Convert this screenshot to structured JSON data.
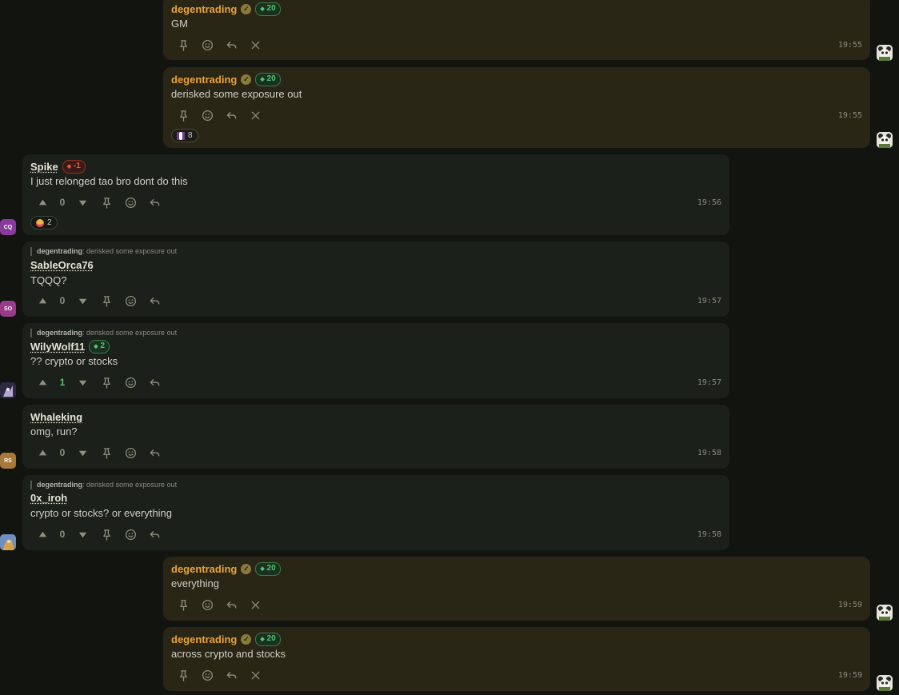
{
  "colors": {
    "background": "#121410",
    "own_bubble": "#2a2616",
    "other_bubble": "#1b201a",
    "own_name": "#e8a33a",
    "rep_positive": "#58c270",
    "rep_negative": "#e05a4a"
  },
  "messages": [
    {
      "author": "degentrading",
      "rep": "20",
      "text": "GM",
      "time": "19:55"
    },
    {
      "author": "degentrading",
      "rep": "20",
      "text": "derisked some exposure out",
      "time": "19:55",
      "reaction_count": "8"
    },
    {
      "author": "Spike",
      "rep": "-1",
      "text": "I just relonged tao bro dont do this",
      "time": "19:56",
      "votes": "0",
      "reaction_count": "2",
      "avatar_initials": "CQ"
    },
    {
      "author": "SableOrca76",
      "reply_to_author": "degentrading",
      "reply_to_text": ": derisked some exposure out",
      "text": "TQQQ?",
      "time": "19:57",
      "votes": "0",
      "avatar_initials": "SO"
    },
    {
      "author": "WilyWolf11",
      "rep": "2",
      "reply_to_author": "degentrading",
      "reply_to_text": ": derisked some exposure out",
      "text": "?? crypto or stocks",
      "time": "19:57",
      "votes": "1"
    },
    {
      "author": "Whaleking",
      "text": "omg, run?",
      "time": "19:58",
      "votes": "0",
      "avatar_initials": "RS"
    },
    {
      "author": "0x_iroh",
      "reply_to_author": "degentrading",
      "reply_to_text": ": derisked some exposure out",
      "text": "crypto or stocks? or everything",
      "time": "19:58",
      "votes": "0"
    },
    {
      "author": "degentrading",
      "rep": "20",
      "text": "everything",
      "time": "19:59"
    },
    {
      "author": "degentrading",
      "rep": "20",
      "text": "across crypto and stocks",
      "time": "19:59"
    }
  ],
  "icons": {
    "pin": "pin-icon",
    "emoji": "smiley-icon",
    "reply": "reply-icon",
    "delete": "close-icon",
    "upvote": "upvote-icon",
    "downvote": "downvote-icon",
    "verified": "verified-check-icon",
    "rep": "diamond-icon"
  }
}
